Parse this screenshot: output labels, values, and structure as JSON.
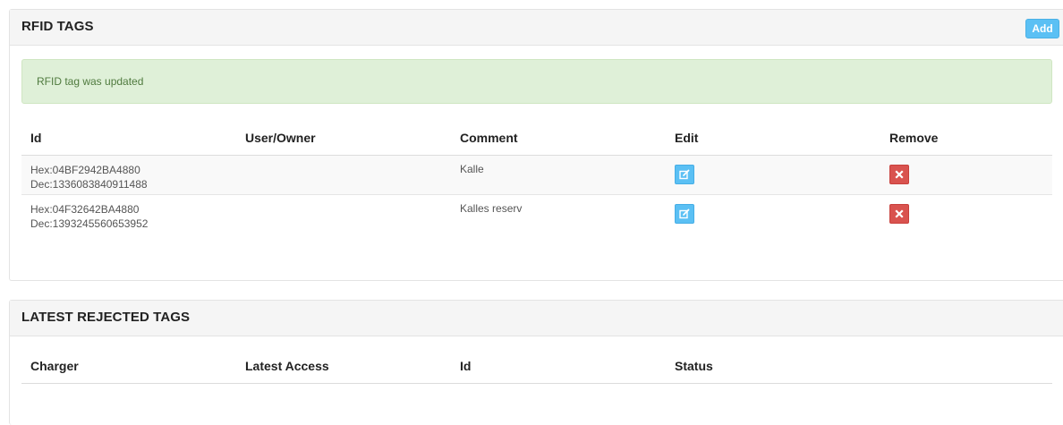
{
  "rfid_tags": {
    "title": "RFID TAGS",
    "add_label": "Add",
    "alert_message": "RFID tag was updated",
    "columns": [
      "Id",
      "User/Owner",
      "Comment",
      "Edit",
      "Remove"
    ],
    "rows": [
      {
        "hex": "Hex:04BF2942BA4880",
        "dec": "Dec:1336083840911488",
        "owner": "",
        "comment": "Kalle"
      },
      {
        "hex": "Hex:04F32642BA4880",
        "dec": "Dec:1393245560653952",
        "owner": "",
        "comment": "Kalles reserv"
      }
    ],
    "icons": {
      "edit": "edit-icon",
      "remove": "close-icon"
    },
    "colors": {
      "edit": "#5bc0f4",
      "remove": "#d9534f",
      "alert_bg": "#dff0d8",
      "add": "#5bc0f4"
    }
  },
  "rejected_tags": {
    "title": "LATEST REJECTED TAGS",
    "columns": [
      "Charger",
      "Latest Access",
      "Id",
      "Status"
    ]
  }
}
